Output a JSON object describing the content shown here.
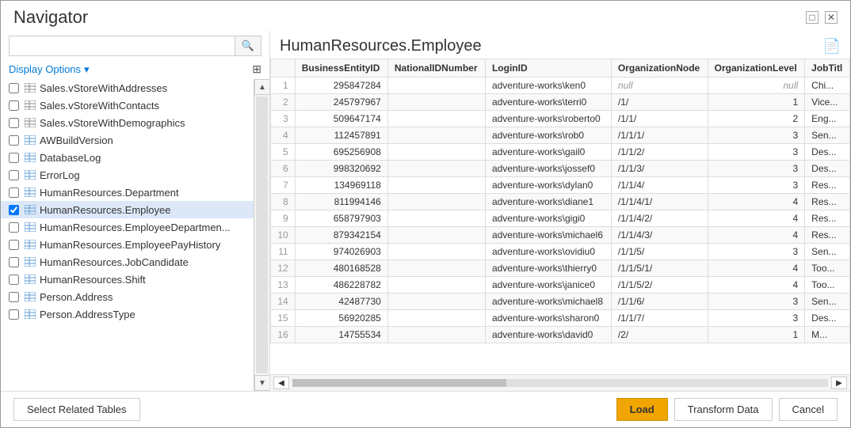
{
  "window": {
    "title": "Navigator",
    "minimize_label": "□",
    "close_label": "✕"
  },
  "left_panel": {
    "search_placeholder": "",
    "display_options_label": "Display Options",
    "display_options_arrow": "▾",
    "export_icon_label": "⊞",
    "items": [
      {
        "id": 1,
        "label": "Sales.vStoreWithAddresses",
        "checked": false,
        "type": "view",
        "selected": false
      },
      {
        "id": 2,
        "label": "Sales.vStoreWithContacts",
        "checked": false,
        "type": "view",
        "selected": false
      },
      {
        "id": 3,
        "label": "Sales.vStoreWithDemographics",
        "checked": false,
        "type": "view",
        "selected": false
      },
      {
        "id": 4,
        "label": "AWBuildVersion",
        "checked": false,
        "type": "table",
        "selected": false
      },
      {
        "id": 5,
        "label": "DatabaseLog",
        "checked": false,
        "type": "table",
        "selected": false
      },
      {
        "id": 6,
        "label": "ErrorLog",
        "checked": false,
        "type": "table",
        "selected": false
      },
      {
        "id": 7,
        "label": "HumanResources.Department",
        "checked": false,
        "type": "table",
        "selected": false
      },
      {
        "id": 8,
        "label": "HumanResources.Employee",
        "checked": true,
        "type": "table",
        "selected": true
      },
      {
        "id": 9,
        "label": "HumanResources.EmployeeDepartmen...",
        "checked": false,
        "type": "table",
        "selected": false
      },
      {
        "id": 10,
        "label": "HumanResources.EmployeePayHistory",
        "checked": false,
        "type": "table",
        "selected": false
      },
      {
        "id": 11,
        "label": "HumanResources.JobCandidate",
        "checked": false,
        "type": "table",
        "selected": false
      },
      {
        "id": 12,
        "label": "HumanResources.Shift",
        "checked": false,
        "type": "table",
        "selected": false
      },
      {
        "id": 13,
        "label": "Person.Address",
        "checked": false,
        "type": "table",
        "selected": false
      },
      {
        "id": 14,
        "label": "Person.AddressType",
        "checked": false,
        "type": "table",
        "selected": false
      }
    ]
  },
  "right_panel": {
    "title": "HumanResources.Employee",
    "columns": [
      "BusinessEntityID",
      "NationalIDNumber",
      "LoginID",
      "OrganizationNode",
      "OrganizationLevel",
      "JobTitl"
    ],
    "rows": [
      {
        "num": 1,
        "BusinessEntityID": 295847284,
        "NationalIDNumber": "",
        "LoginID": "adventure-works\\ken0",
        "OrganizationNode": "",
        "OrganizationLevel": "null",
        "JobTitle": "Chi..."
      },
      {
        "num": 2,
        "BusinessEntityID": 245797967,
        "NationalIDNumber": "",
        "LoginID": "adventure-works\\terri0",
        "OrganizationNode": "/1/",
        "OrganizationLevel": 1,
        "JobTitle": "Vice..."
      },
      {
        "num": 3,
        "BusinessEntityID": 509647174,
        "NationalIDNumber": "",
        "LoginID": "adventure-works\\roberto0",
        "OrganizationNode": "/1/1/",
        "OrganizationLevel": 2,
        "JobTitle": "Eng..."
      },
      {
        "num": 4,
        "BusinessEntityID": 112457891,
        "NationalIDNumber": "",
        "LoginID": "adventure-works\\rob0",
        "OrganizationNode": "/1/1/1/",
        "OrganizationLevel": 3,
        "JobTitle": "Sen..."
      },
      {
        "num": 5,
        "BusinessEntityID": 695256908,
        "NationalIDNumber": "",
        "LoginID": "adventure-works\\gail0",
        "OrganizationNode": "/1/1/2/",
        "OrganizationLevel": 3,
        "JobTitle": "Des..."
      },
      {
        "num": 6,
        "BusinessEntityID": 998320692,
        "NationalIDNumber": "",
        "LoginID": "adventure-works\\jossef0",
        "OrganizationNode": "/1/1/3/",
        "OrganizationLevel": 3,
        "JobTitle": "Des..."
      },
      {
        "num": 7,
        "BusinessEntityID": 134969118,
        "NationalIDNumber": "",
        "LoginID": "adventure-works\\dylan0",
        "OrganizationNode": "/1/1/4/",
        "OrganizationLevel": 3,
        "JobTitle": "Res..."
      },
      {
        "num": 8,
        "BusinessEntityID": 811994146,
        "NationalIDNumber": "",
        "LoginID": "adventure-works\\diane1",
        "OrganizationNode": "/1/1/4/1/",
        "OrganizationLevel": 4,
        "JobTitle": "Res..."
      },
      {
        "num": 9,
        "BusinessEntityID": 658797903,
        "NationalIDNumber": "",
        "LoginID": "adventure-works\\gigi0",
        "OrganizationNode": "/1/1/4/2/",
        "OrganizationLevel": 4,
        "JobTitle": "Res..."
      },
      {
        "num": 10,
        "BusinessEntityID": 879342154,
        "NationalIDNumber": "",
        "LoginID": "adventure-works\\michael6",
        "OrganizationNode": "/1/1/4/3/",
        "OrganizationLevel": 4,
        "JobTitle": "Res..."
      },
      {
        "num": 11,
        "BusinessEntityID": 974026903,
        "NationalIDNumber": "",
        "LoginID": "adventure-works\\ovidiu0",
        "OrganizationNode": "/1/1/5/",
        "OrganizationLevel": 3,
        "JobTitle": "Sen..."
      },
      {
        "num": 12,
        "BusinessEntityID": 480168528,
        "NationalIDNumber": "",
        "LoginID": "adventure-works\\thierry0",
        "OrganizationNode": "/1/1/5/1/",
        "OrganizationLevel": 4,
        "JobTitle": "Too..."
      },
      {
        "num": 13,
        "BusinessEntityID": 486228782,
        "NationalIDNumber": "",
        "LoginID": "adventure-works\\janice0",
        "OrganizationNode": "/1/1/5/2/",
        "OrganizationLevel": 4,
        "JobTitle": "Too..."
      },
      {
        "num": 14,
        "BusinessEntityID": 42487730,
        "NationalIDNumber": "",
        "LoginID": "adventure-works\\michael8",
        "OrganizationNode": "/1/1/6/",
        "OrganizationLevel": 3,
        "JobTitle": "Sen..."
      },
      {
        "num": 15,
        "BusinessEntityID": 56920285,
        "NationalIDNumber": "",
        "LoginID": "adventure-works\\sharon0",
        "OrganizationNode": "/1/1/7/",
        "OrganizationLevel": 3,
        "JobTitle": "Des..."
      },
      {
        "num": 16,
        "BusinessEntityID": 14755534,
        "NationalIDNumber": "",
        "LoginID": "adventure-works\\david0",
        "OrganizationNode": "/2/",
        "OrganizationLevel": 1,
        "JobTitle": "M..."
      }
    ]
  },
  "bottom_bar": {
    "select_related_label": "Select Related Tables",
    "load_label": "Load",
    "transform_label": "Transform Data",
    "cancel_label": "Cancel"
  }
}
